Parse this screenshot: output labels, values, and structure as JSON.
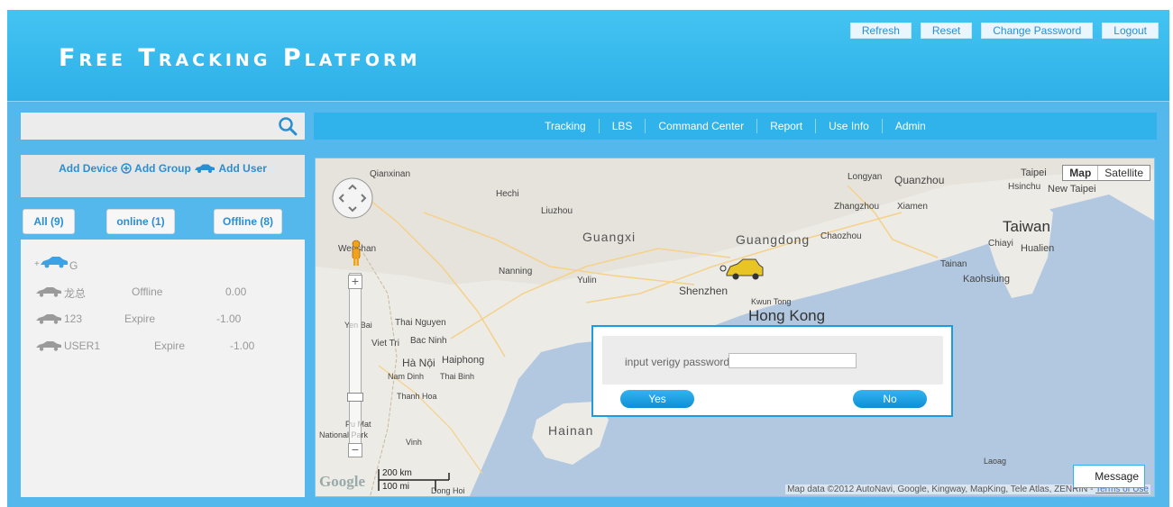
{
  "header": {
    "title": "Free Tracking Platform",
    "actions": [
      "Refresh",
      "Reset",
      "Change Password",
      "Logout"
    ]
  },
  "search": {
    "value": "",
    "placeholder": ""
  },
  "add_panel": {
    "add_device": "Add Device",
    "add_group": "Add Group",
    "add_user": "Add User"
  },
  "status_tabs": [
    {
      "label": "All (9)"
    },
    {
      "label": "online (1)"
    },
    {
      "label": "Offline (8)"
    }
  ],
  "devices": [
    {
      "name": "G",
      "status": "",
      "value": ""
    },
    {
      "name": "龙总",
      "status": "Offline",
      "value": "0.00"
    },
    {
      "name": "123",
      "status": "Expire",
      "value": "-1.00"
    },
    {
      "name": "USER1",
      "status": "Expire",
      "value": "-1.00"
    }
  ],
  "nav": [
    "Tracking",
    "LBS",
    "Command Center",
    "Report",
    "Use Info",
    "Admin"
  ],
  "map": {
    "type_buttons": [
      "Map",
      "Satellite"
    ],
    "labels": {
      "qianxinan": "Qianxinan",
      "hechi": "Hechi",
      "liuzhou": "Liuzhou",
      "guangxi": "Guangxi",
      "guangdong": "Guangdong",
      "chaozhou": "Chaozhou",
      "longyan": "Longyan",
      "quanzhou": "Quanzhou",
      "zhangzhou": "Zhangzhou",
      "xiamen": "Xiamen",
      "taipei": "Taipei",
      "hsinchu": "Hsinchu",
      "new_taipei": "New Taipei",
      "taiwan": "Taiwan",
      "chiayi": "Chiayi",
      "hualien": "Hualien",
      "tainan": "Tainan",
      "kaohsiung": "Kaohsiung",
      "nanning": "Nanning",
      "yulin": "Yulin",
      "shenzhen": "Shenzhen",
      "kwun_tong": "Kwun Tong",
      "hong_kong": "Hong Kong",
      "wenshan": "Wenshan",
      "thai_nguyen": "Thai Nguyen",
      "yen_bai": "Yen Bai",
      "bac_ninh": "Bac Ninh",
      "viet_tri": "Viet Tri",
      "ha_noi": "Hà Nội",
      "haiphong": "Haiphong",
      "nam_dinh": "Nam Dinh",
      "thai_binh": "Thai Binh",
      "thanh_hoa": "Thanh Hoa",
      "hainan": "Hainan",
      "pu_mat": "Pu Mat",
      "national_park": "National Park",
      "vinh": "Vinh",
      "laoag": "Laoag",
      "dong_hoi": "Dong Hoi"
    },
    "scale_km": "200 km",
    "scale_mi": "100 mi",
    "logo": "Google",
    "attribution": "Map data ©2012 AutoNavi, Google, Kingway, MapKing, Tele Atlas, ZENRIN -",
    "terms": "Terms of Use",
    "message_button": "Message"
  },
  "dialog": {
    "label": "input verigy password:",
    "password_value": "",
    "yes": "Yes",
    "no": "No"
  },
  "colors": {
    "header": "#3bbcef",
    "accent": "#2a8fd0",
    "button": "#1a9be2"
  }
}
